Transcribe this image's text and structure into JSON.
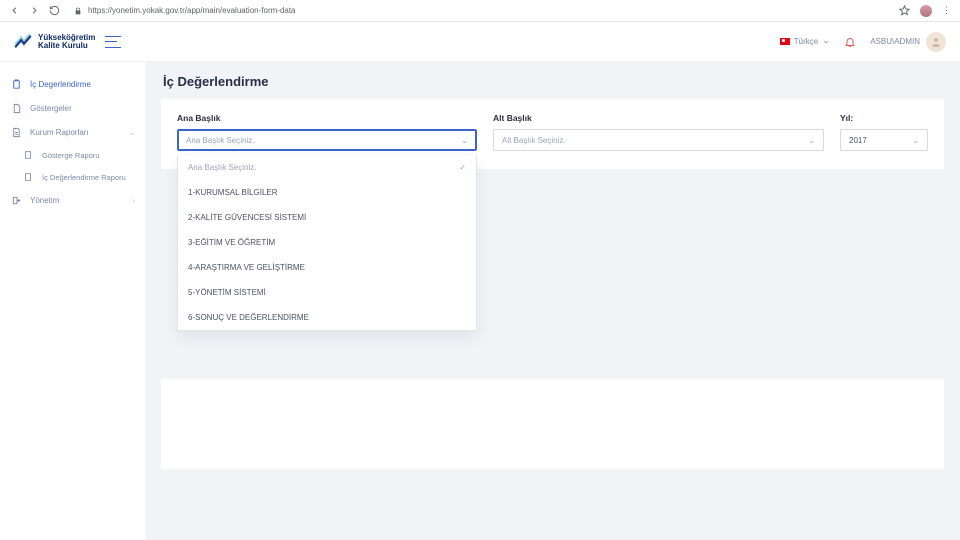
{
  "browser": {
    "url": "https://yonetim.yokak.gov.tr/app/main/evaluation-form-data"
  },
  "brand": {
    "line1": "Yükseköğretim",
    "line2": "Kalite Kurulu"
  },
  "header": {
    "language": "Türkçe",
    "username": "ASBU\\ADMIN"
  },
  "sidebar": {
    "items": [
      {
        "label": "İç Degerlendirme"
      },
      {
        "label": "Göstergeler"
      },
      {
        "label": "Kurum Raporları"
      },
      {
        "label": "Yönetim"
      }
    ],
    "sub_reports": [
      {
        "label": "Gösterge Raporu"
      },
      {
        "label": "İç Değerlendirme Raporu"
      }
    ]
  },
  "page": {
    "title": "İç Değerlendirme"
  },
  "filters": {
    "ana": {
      "label": "Ana Başlık",
      "placeholder": "Ana Başlık Seçiniz."
    },
    "alt": {
      "label": "Alt Başlık",
      "placeholder": "Alt Başlık Seçiniz."
    },
    "yil": {
      "label": "Yıl:",
      "value": "2017"
    }
  },
  "ana_options": [
    "Ana Başlık Seçiniz.",
    "1-KURUMSAL BİLGİLER",
    "2-KALİTE GÜVENCESİ SİSTEMİ",
    "3-EĞİTİM VE ÖĞRETİM",
    "4-ARAŞTIRMA VE GELİŞTİRME",
    "5-YÖNETİM SİSTEMİ",
    "6-SONUÇ VE DEĞERLENDİRME"
  ]
}
